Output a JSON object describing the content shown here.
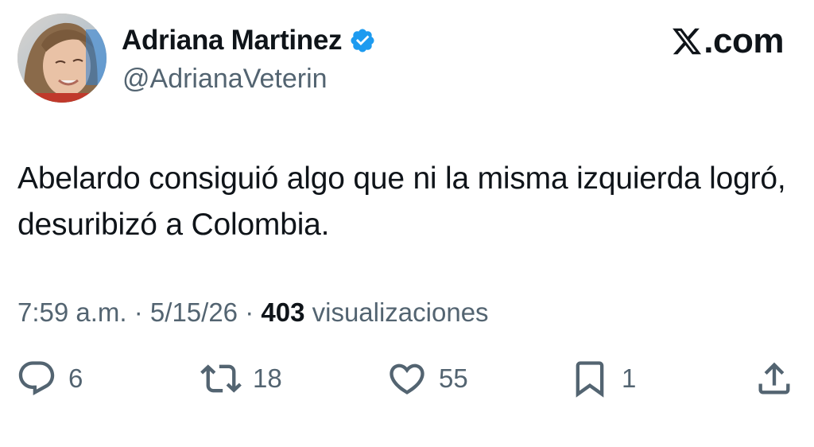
{
  "author": {
    "display_name": "Adriana Martinez",
    "handle": "@AdrianaVeterin",
    "verified": true,
    "verified_color": "#1d9bf0"
  },
  "brand": {
    "label": ".com",
    "icon": "x-logo-icon"
  },
  "tweet": {
    "text": "Abelardo consiguió algo que ni la misma izquierda logró, desuribizó a Colombia."
  },
  "meta": {
    "time": "7:59 a.m.",
    "separator": "·",
    "date": "5/15/26",
    "views_count": "403",
    "views_label": "visualizaciones"
  },
  "actions": {
    "replies": {
      "icon": "reply-icon",
      "count": "6"
    },
    "reposts": {
      "icon": "repost-icon",
      "count": "18"
    },
    "likes": {
      "icon": "heart-icon",
      "count": "55"
    },
    "bookmarks": {
      "icon": "bookmark-icon",
      "count": "1"
    },
    "share": {
      "icon": "share-icon"
    }
  },
  "colors": {
    "text_primary": "#0f1419",
    "text_secondary": "#536471",
    "accent": "#1d9bf0"
  }
}
